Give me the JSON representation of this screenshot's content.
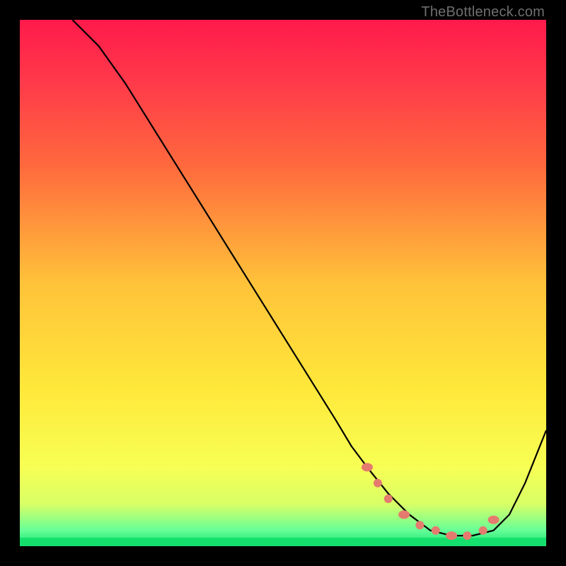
{
  "watermark": "TheBottleneck.com",
  "gradient": {
    "stops": [
      {
        "offset": 0.0,
        "color": "#ff1a4b"
      },
      {
        "offset": 0.12,
        "color": "#ff3a4a"
      },
      {
        "offset": 0.28,
        "color": "#ff6a3d"
      },
      {
        "offset": 0.5,
        "color": "#ffc23a"
      },
      {
        "offset": 0.7,
        "color": "#ffe83a"
      },
      {
        "offset": 0.85,
        "color": "#f7ff54"
      },
      {
        "offset": 0.92,
        "color": "#d8ff66"
      },
      {
        "offset": 0.97,
        "color": "#66ff98"
      },
      {
        "offset": 1.0,
        "color": "#15e06e"
      }
    ]
  },
  "colors": {
    "curve_stroke": "#000000",
    "marker_fill": "#e57b6e",
    "green_band": "#15e06e"
  },
  "chart_data": {
    "type": "line",
    "title": "",
    "xlabel": "",
    "ylabel": "",
    "xlim": [
      0,
      100
    ],
    "ylim": [
      0,
      100
    ],
    "series": [
      {
        "name": "bottleneck-curve",
        "x": [
          10,
          15,
          20,
          25,
          30,
          35,
          40,
          45,
          50,
          55,
          60,
          63,
          66,
          70,
          74,
          78,
          82,
          86,
          90,
          93,
          96,
          100
        ],
        "y": [
          100,
          95,
          88,
          80,
          72,
          64,
          56,
          48,
          40,
          32,
          24,
          19,
          15,
          10,
          6,
          3,
          2,
          2,
          3,
          6,
          12,
          22
        ]
      }
    ],
    "markers": {
      "name": "highlighted-points",
      "x": [
        66,
        68,
        70,
        73,
        76,
        79,
        82,
        85,
        88,
        90
      ],
      "y": [
        15,
        12,
        9,
        6,
        4,
        3,
        2,
        2,
        3,
        5
      ]
    }
  }
}
